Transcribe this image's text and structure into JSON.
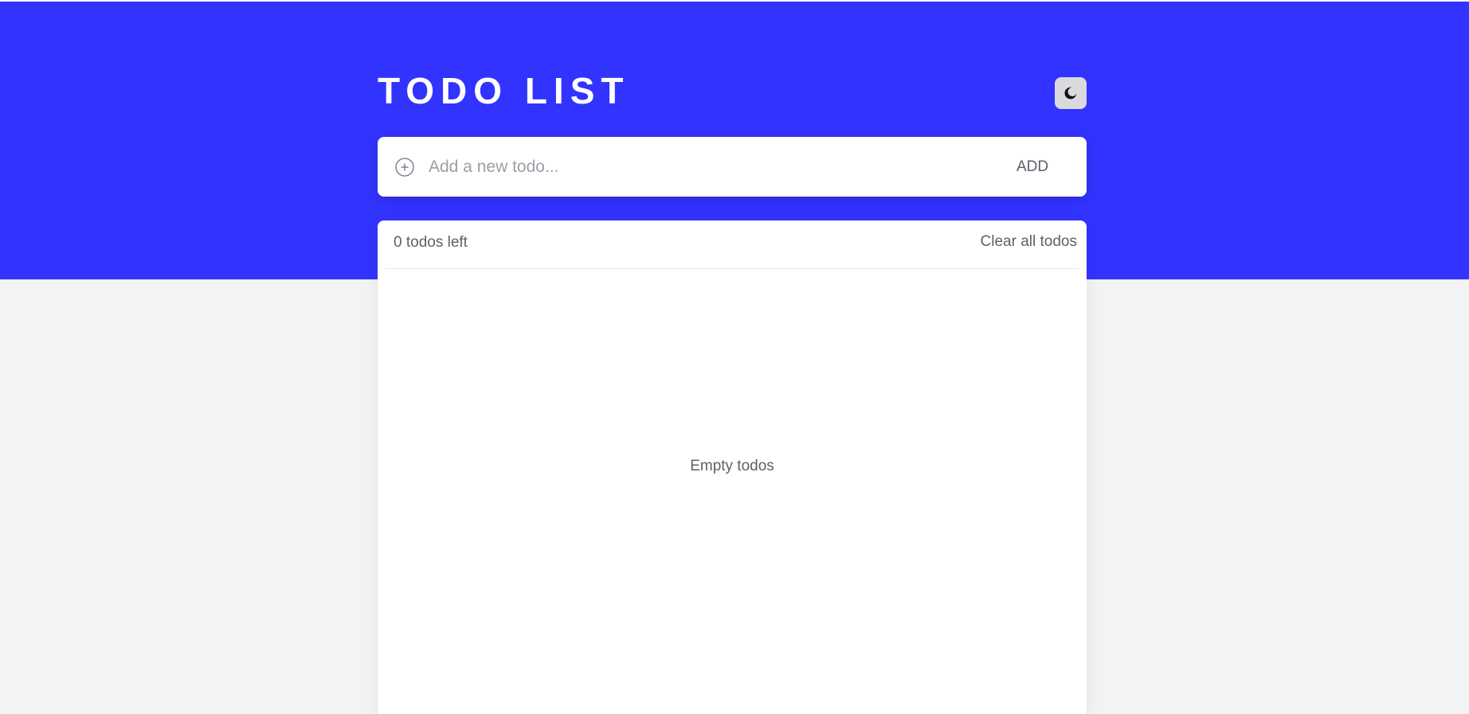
{
  "header": {
    "title": "TODO LIST",
    "theme_toggle_icon": "moon-icon"
  },
  "add_todo": {
    "input_icon": "plus-circle-icon",
    "placeholder": "Add a new todo...",
    "value": "",
    "add_label": "ADD"
  },
  "list": {
    "todos_left_label": "0 todos left",
    "clear_all_label": "Clear all todos",
    "empty_message": "Empty todos",
    "items": []
  },
  "colors": {
    "hero_background": "#3333ff",
    "page_background": "#f2f3f5",
    "card_background": "#ffffff",
    "text_muted": "#5b616b",
    "toggle_background": "#d9d9de"
  }
}
